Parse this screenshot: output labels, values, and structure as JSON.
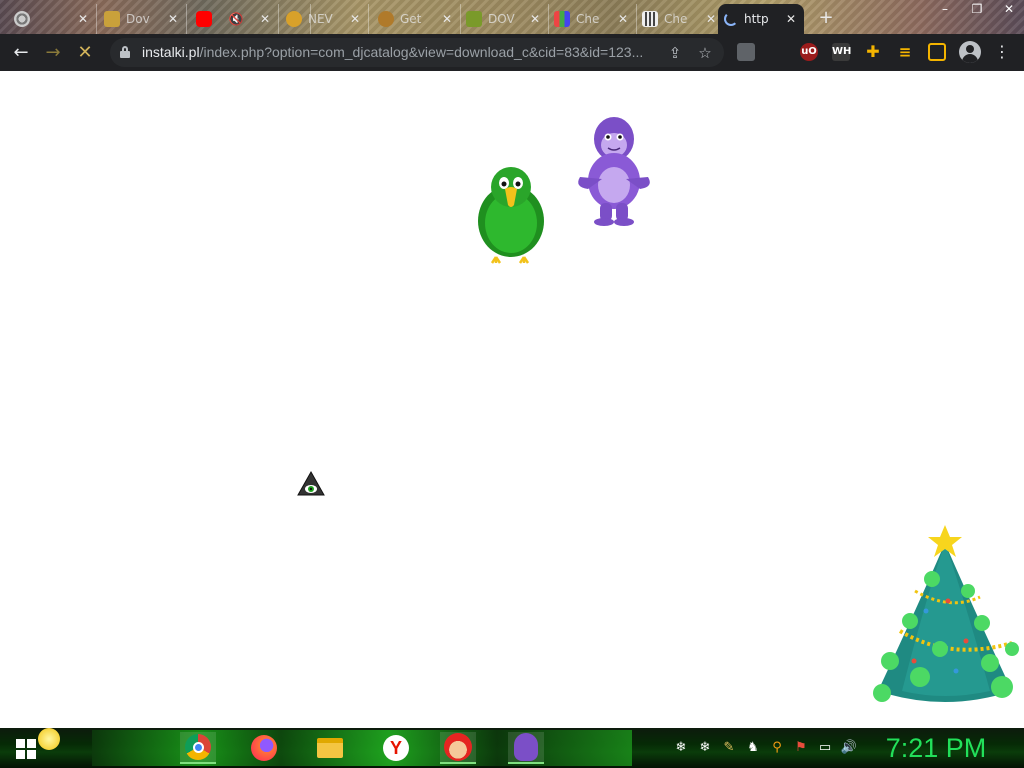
{
  "browser": {
    "tabs": [
      {
        "title": "",
        "favicon": "settings-icon",
        "active": false
      },
      {
        "title": "Dov",
        "favicon": "package-icon",
        "active": false
      },
      {
        "title": "",
        "favicon": "youtube-icon",
        "active": false
      },
      {
        "title": "",
        "favicon": "speaker-muted-icon",
        "active": false
      },
      {
        "title": "NEV",
        "favicon": "globe-icon",
        "active": false
      },
      {
        "title": "Get",
        "favicon": "bug-icon",
        "active": false
      },
      {
        "title": "DOV",
        "favicon": "download-icon",
        "active": false
      },
      {
        "title": "Che",
        "favicon": "chart-icon",
        "active": false
      },
      {
        "title": "Che",
        "favicon": "columns-icon",
        "active": false
      },
      {
        "title": "http",
        "favicon": "loading-icon",
        "active": true
      }
    ],
    "close_glyph": "✕",
    "new_tab_glyph": "+",
    "window_controls": {
      "minimize": "–",
      "maximize": "❐",
      "close": "✕"
    },
    "toolbar": {
      "back_glyph": "←",
      "forward_glyph": "→",
      "stop_glyph": "✕",
      "url_host": "instalki.pl",
      "url_path": "/index.php?option=com_djcatalog&view=download_c&cid=83&id=123...",
      "share_glyph": "⇪",
      "star_glyph": "☆",
      "menu_glyph": "⋮"
    },
    "extensions": [
      {
        "name": "ublock-origin-extension-icon",
        "label": "uO",
        "color": "#9b1c1c"
      },
      {
        "name": "wh-extension-icon",
        "label": "WH",
        "color": "#3a3a3a"
      },
      {
        "name": "puzzle-extension-icon",
        "label": "",
        "color": "#f4b400"
      },
      {
        "name": "reading-list-icon",
        "label": "",
        "color": "#f4b400"
      },
      {
        "name": "side-panel-icon",
        "label": "",
        "color": "#f4b400"
      }
    ]
  },
  "taskbar": {
    "clock": "7:21 PM",
    "apps": [
      {
        "name": "chrome-taskbar-icon",
        "running": true
      },
      {
        "name": "firefox-taskbar-icon",
        "running": false
      },
      {
        "name": "file-explorer-taskbar-icon",
        "running": false
      },
      {
        "name": "yandex-taskbar-icon",
        "running": false
      },
      {
        "name": "mario-app-taskbar-icon",
        "running": true
      },
      {
        "name": "bonzi-buddy-taskbar-icon",
        "running": true
      }
    ],
    "tray": [
      "❄",
      "❄",
      "✎",
      "♞",
      "⚲",
      "⚑",
      "▭",
      "🔊"
    ]
  }
}
